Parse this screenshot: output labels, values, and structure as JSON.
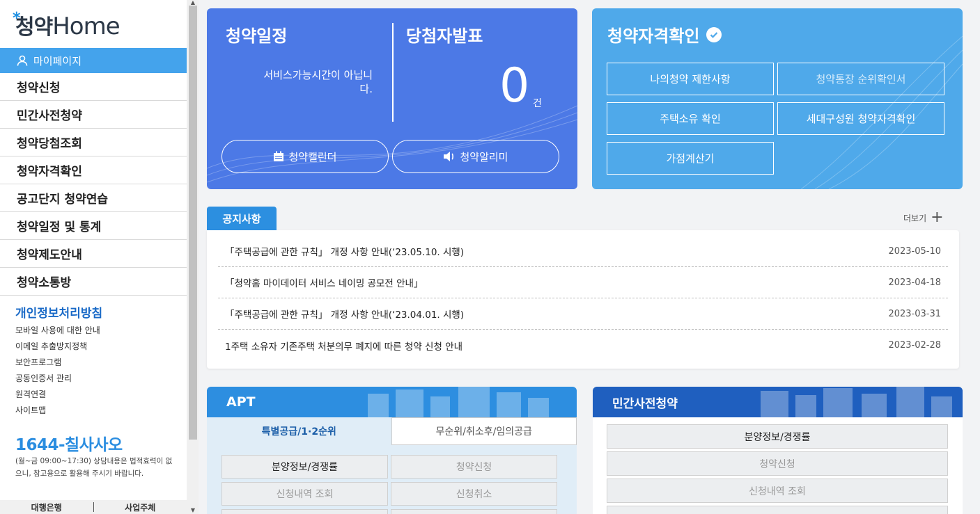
{
  "sidebar": {
    "logo_kr": "청약",
    "logo_en": "Home",
    "mypage": "마이페이지",
    "menu": [
      "청약신청",
      "민간사전청약",
      "청약당첨조회",
      "청약자격확인",
      "공고단지 청약연습",
      "청약일정 및 통계",
      "청약제도안내",
      "청약소통방"
    ],
    "privacy_title": "개인정보처리방침",
    "links": [
      "모바일 사용에 대한 안내",
      "이메일 추출방지정책",
      "보안프로그램",
      "공동인증서 관리",
      "원격연결",
      "사이트맵"
    ],
    "phone": "1644-칠사사오",
    "phone_note": "(월~금 09:00~17:30) 상담내용은 법적효력이 없으니, 참고용으로 활용해 주시기 바랍니다.",
    "bottom": [
      "대행은행",
      "사업주체"
    ]
  },
  "schedule_card": {
    "title_schedule": "청약일정",
    "title_winner": "당첨자발표",
    "notice": "서비스가능시간이 아닙니다.",
    "count": "0",
    "unit": "건",
    "calendar_btn": "청약캘린더",
    "alarm_btn": "청약알리미",
    "color": "#4c79e6"
  },
  "qualification_card": {
    "title": "청약자격확인",
    "buttons": [
      "나의청약 제한사항",
      "청약통장 순위확인서",
      "주택소유 확인",
      "세대구성원 청약자격확인",
      "가점계산기"
    ],
    "color": "#4fa9ea"
  },
  "notices": {
    "tab": "공지사항",
    "more": "더보기",
    "items": [
      {
        "title": "「주택공급에 관한 규칙」 개정 사항 안내(‘23.05.10. 시행)",
        "date": "2023-05-10"
      },
      {
        "title": "「청약홈 마이데이터 서비스 네이밍 공모전 안내」",
        "date": "2023-04-18"
      },
      {
        "title": "「주택공급에 관한 규칙」 개정 사항 안내(‘23.04.01. 시행)",
        "date": "2023-03-31"
      },
      {
        "title": "1주택 소유자 기존주택 처분의무 폐지에 따른 청약 신청 안내",
        "date": "2023-02-28"
      }
    ]
  },
  "apt": {
    "title": "APT",
    "tabs": [
      "특별공급/1·2순위",
      "무순위/취소후/임의공급"
    ],
    "buttons": [
      "분양정보/경쟁률",
      "청약신청",
      "신청내역 조회",
      "신청취소"
    ]
  },
  "presale": {
    "title": "민간사전청약",
    "buttons": [
      "분양정보/경쟁률",
      "청약신청",
      "신청내역 조회"
    ]
  }
}
